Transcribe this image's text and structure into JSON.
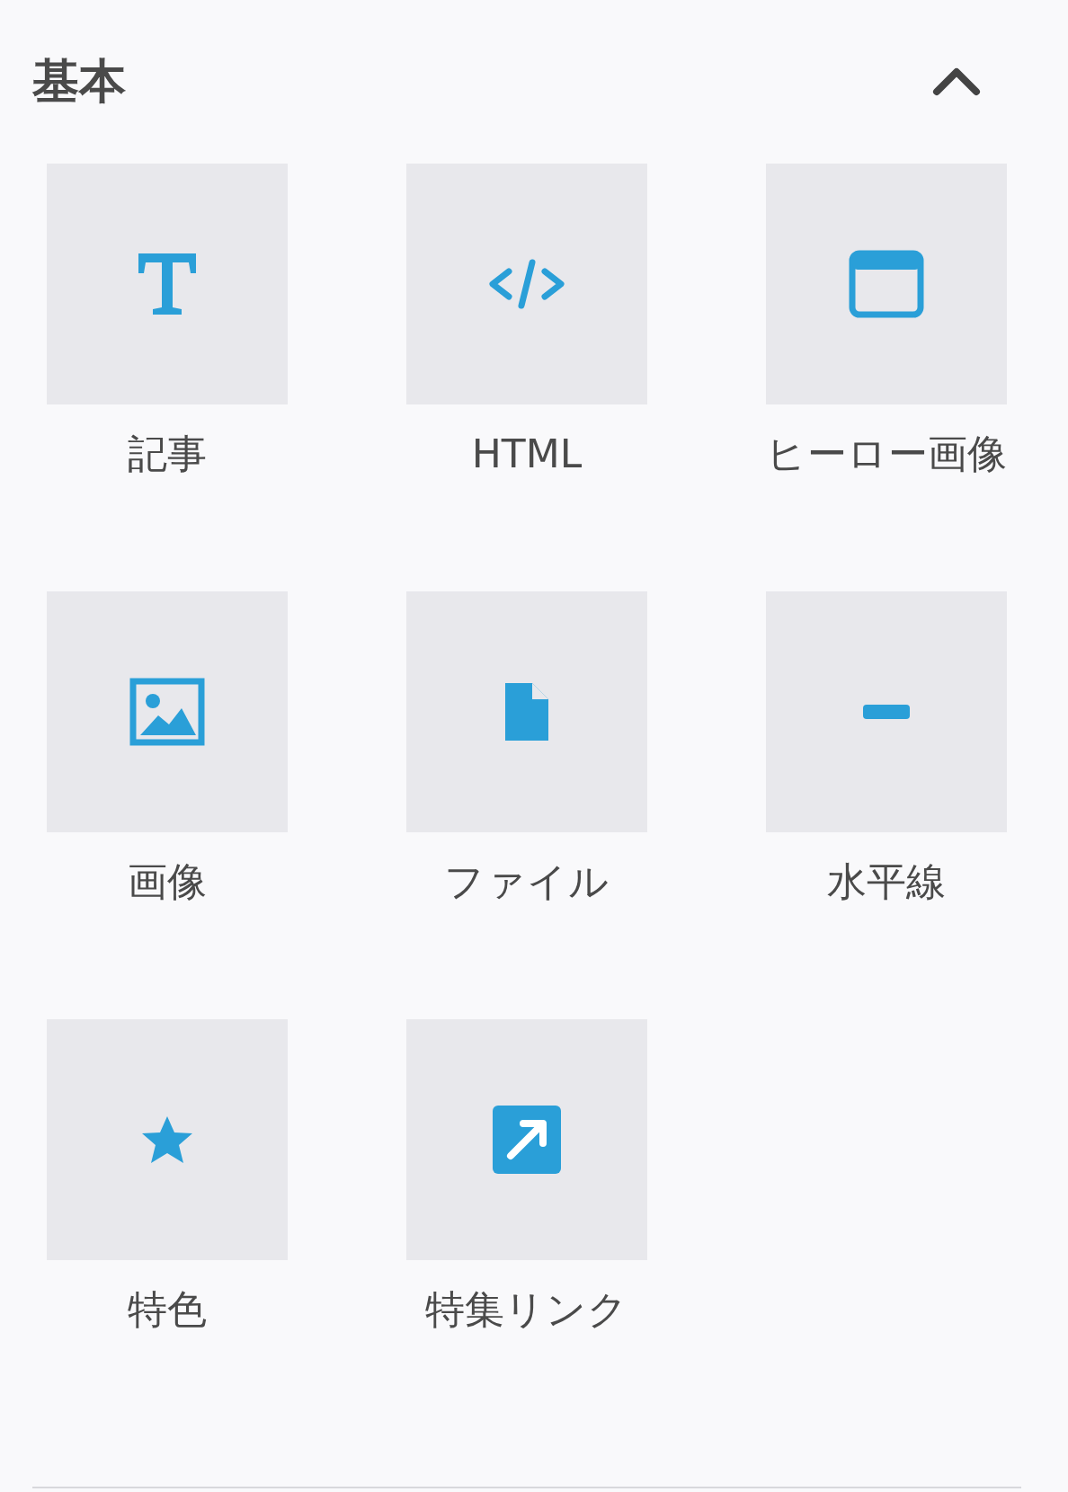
{
  "section": {
    "title": "基本",
    "expanded": true
  },
  "items": [
    {
      "label": "記事",
      "kind": "text"
    },
    {
      "label": "HTML",
      "kind": "code"
    },
    {
      "label": "ヒーロー画像",
      "kind": "window"
    },
    {
      "label": "画像",
      "kind": "image"
    },
    {
      "label": "ファイル",
      "kind": "file"
    },
    {
      "label": "水平線",
      "kind": "rule"
    },
    {
      "label": "特色",
      "kind": "star"
    },
    {
      "label": "特集リンク",
      "kind": "link"
    }
  ]
}
